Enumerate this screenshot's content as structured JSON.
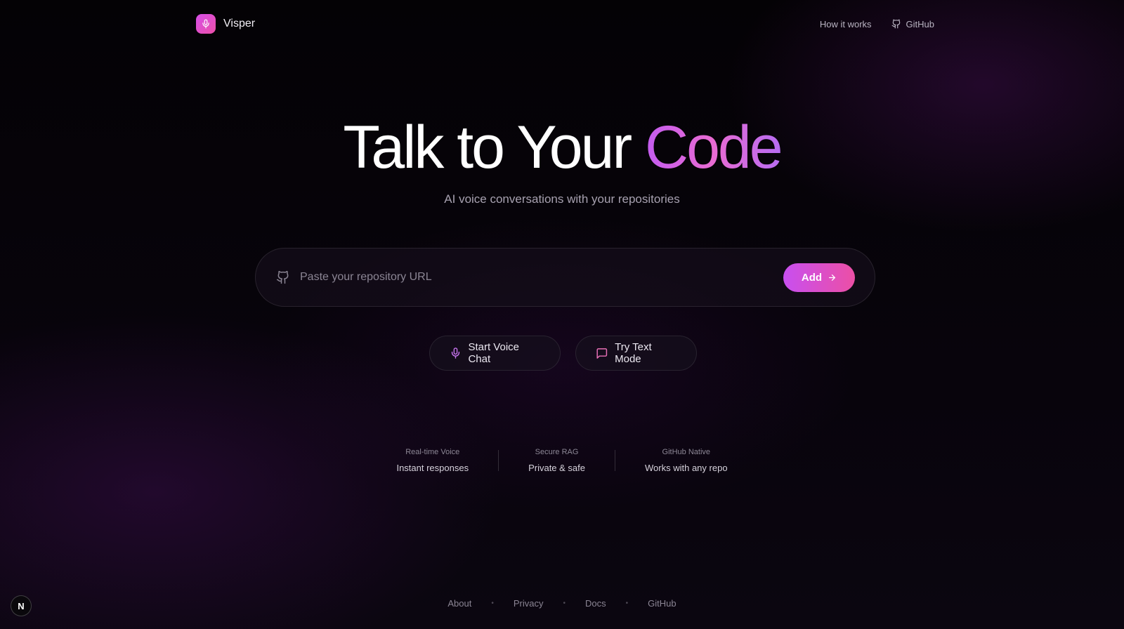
{
  "brand": {
    "name": "Visper",
    "logo_icon": "microphone-icon",
    "accent_from": "#d64fe8",
    "accent_to": "#ec4fa8"
  },
  "nav": {
    "how_it_works": "How it works",
    "github": "GitHub"
  },
  "hero": {
    "title_main": "Talk to Your ",
    "title_accent": "Code",
    "subtitle": "AI voice conversations with your repositories"
  },
  "url_input": {
    "placeholder": "Paste your repository URL",
    "value": "",
    "icon": "github-icon",
    "add_label": "Add"
  },
  "actions": {
    "voice": "Start Voice Chat",
    "text": "Try Text Mode"
  },
  "features": [
    {
      "title": "Real-time Voice",
      "desc": "Instant responses"
    },
    {
      "title": "Secure RAG",
      "desc": "Private & safe"
    },
    {
      "title": "GitHub Native",
      "desc": "Works with any repo"
    }
  ],
  "footer": {
    "about": "About",
    "privacy": "Privacy",
    "docs": "Docs",
    "github": "GitHub"
  },
  "badge": {
    "letter": "N"
  }
}
